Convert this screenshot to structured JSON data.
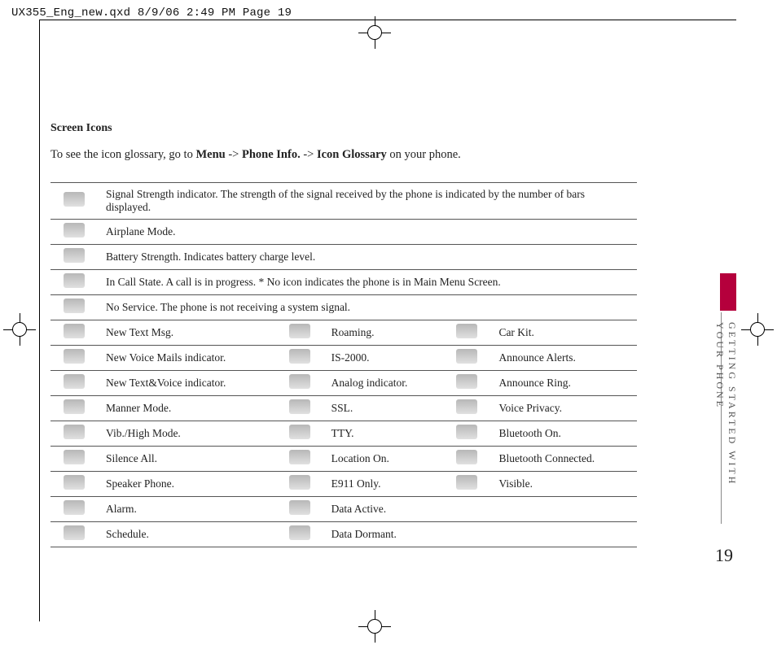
{
  "slug": "UX355_Eng_new.qxd  8/9/06  2:49 PM  Page 19",
  "heading": "Screen Icons",
  "intro_pre": "To see the icon glossary, go to ",
  "intro_b1": "Menu",
  "intro_m1": " -> ",
  "intro_b2": "Phone Info.",
  "intro_m2": " -> ",
  "intro_b3": "Icon Glossary",
  "intro_post": " on your phone.",
  "full_rows": [
    "Signal Strength indicator. The strength of the signal received by the phone is indicated by the number of bars displayed.",
    "Airplane Mode.",
    "Battery Strength. Indicates battery charge level.",
    "In Call State. A call is in progress. * No icon indicates the phone is in Main Menu Screen.",
    "No Service. The phone is not receiving a system signal."
  ],
  "grid": [
    [
      "New Text Msg.",
      "Roaming.",
      "Car Kit."
    ],
    [
      "New Voice Mails indicator.",
      "IS-2000.",
      "Announce Alerts."
    ],
    [
      "New Text&Voice indicator.",
      "Analog indicator.",
      "Announce Ring."
    ],
    [
      "Manner Mode.",
      "SSL.",
      "Voice Privacy."
    ],
    [
      "Vib./High Mode.",
      "TTY.",
      "Bluetooth On."
    ],
    [
      "Silence All.",
      "Location On.",
      "Bluetooth Connected."
    ],
    [
      "Speaker Phone.",
      "E911 Only.",
      "Visible."
    ],
    [
      "Alarm.",
      "Data Active.",
      ""
    ],
    [
      "Schedule.",
      "Data Dormant.",
      ""
    ]
  ],
  "section_label": "GETTING STARTED WITH YOUR PHONE",
  "page_number": "19"
}
